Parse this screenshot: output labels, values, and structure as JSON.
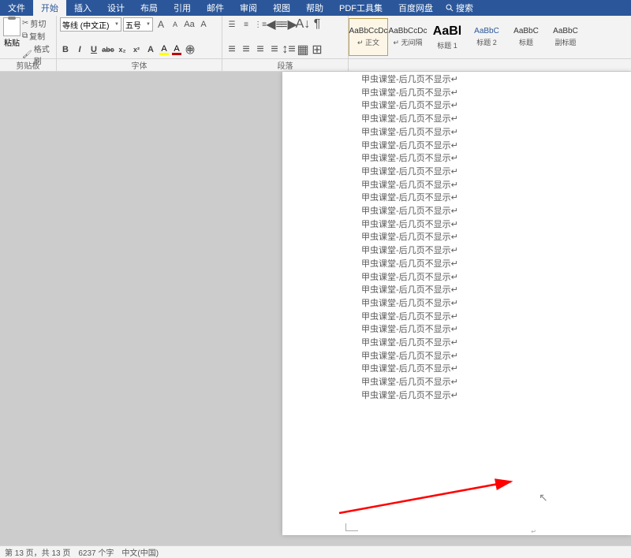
{
  "menubar": {
    "tabs": [
      "文件",
      "开始",
      "插入",
      "设计",
      "布局",
      "引用",
      "邮件",
      "审阅",
      "视图",
      "帮助",
      "PDF工具集",
      "百度网盘"
    ],
    "search_label": "搜索"
  },
  "ribbon": {
    "clipboard": {
      "paste": "粘贴",
      "cut": "剪切",
      "copy": "复制",
      "format_painter": "格式刷",
      "group_label": "剪贴板"
    },
    "font": {
      "name": "等线 (中文正)",
      "size": "五号",
      "group_label": "字体",
      "bold": "B",
      "italic": "I",
      "underline": "U",
      "strike": "abc",
      "sub": "x₂",
      "sup": "x²",
      "grow": "A",
      "shrink": "A",
      "clear": "A",
      "phonetic": "Aa",
      "border": "A",
      "highlight": "A",
      "color": "A"
    },
    "paragraph": {
      "group_label": "段落"
    },
    "styles": [
      {
        "preview": "AaBbCcDc",
        "name": "↵ 正文",
        "cls": ""
      },
      {
        "preview": "AaBbCcDc",
        "name": "↵ 无间隔",
        "cls": ""
      },
      {
        "preview": "AaBl",
        "name": "标题 1",
        "cls": "big"
      },
      {
        "preview": "AaBbC",
        "name": "标题 2",
        "cls": "blue"
      },
      {
        "preview": "AaBbC",
        "name": "标题",
        "cls": ""
      },
      {
        "preview": "AaBbC",
        "name": "副标题",
        "cls": ""
      }
    ]
  },
  "document": {
    "line_text": "甲虫课堂-后几页不显示",
    "line_count": 25
  },
  "statusbar": {
    "page": "第 13 页，共 13 页",
    "words": "6237 个字",
    "language": "中文(中国)"
  }
}
